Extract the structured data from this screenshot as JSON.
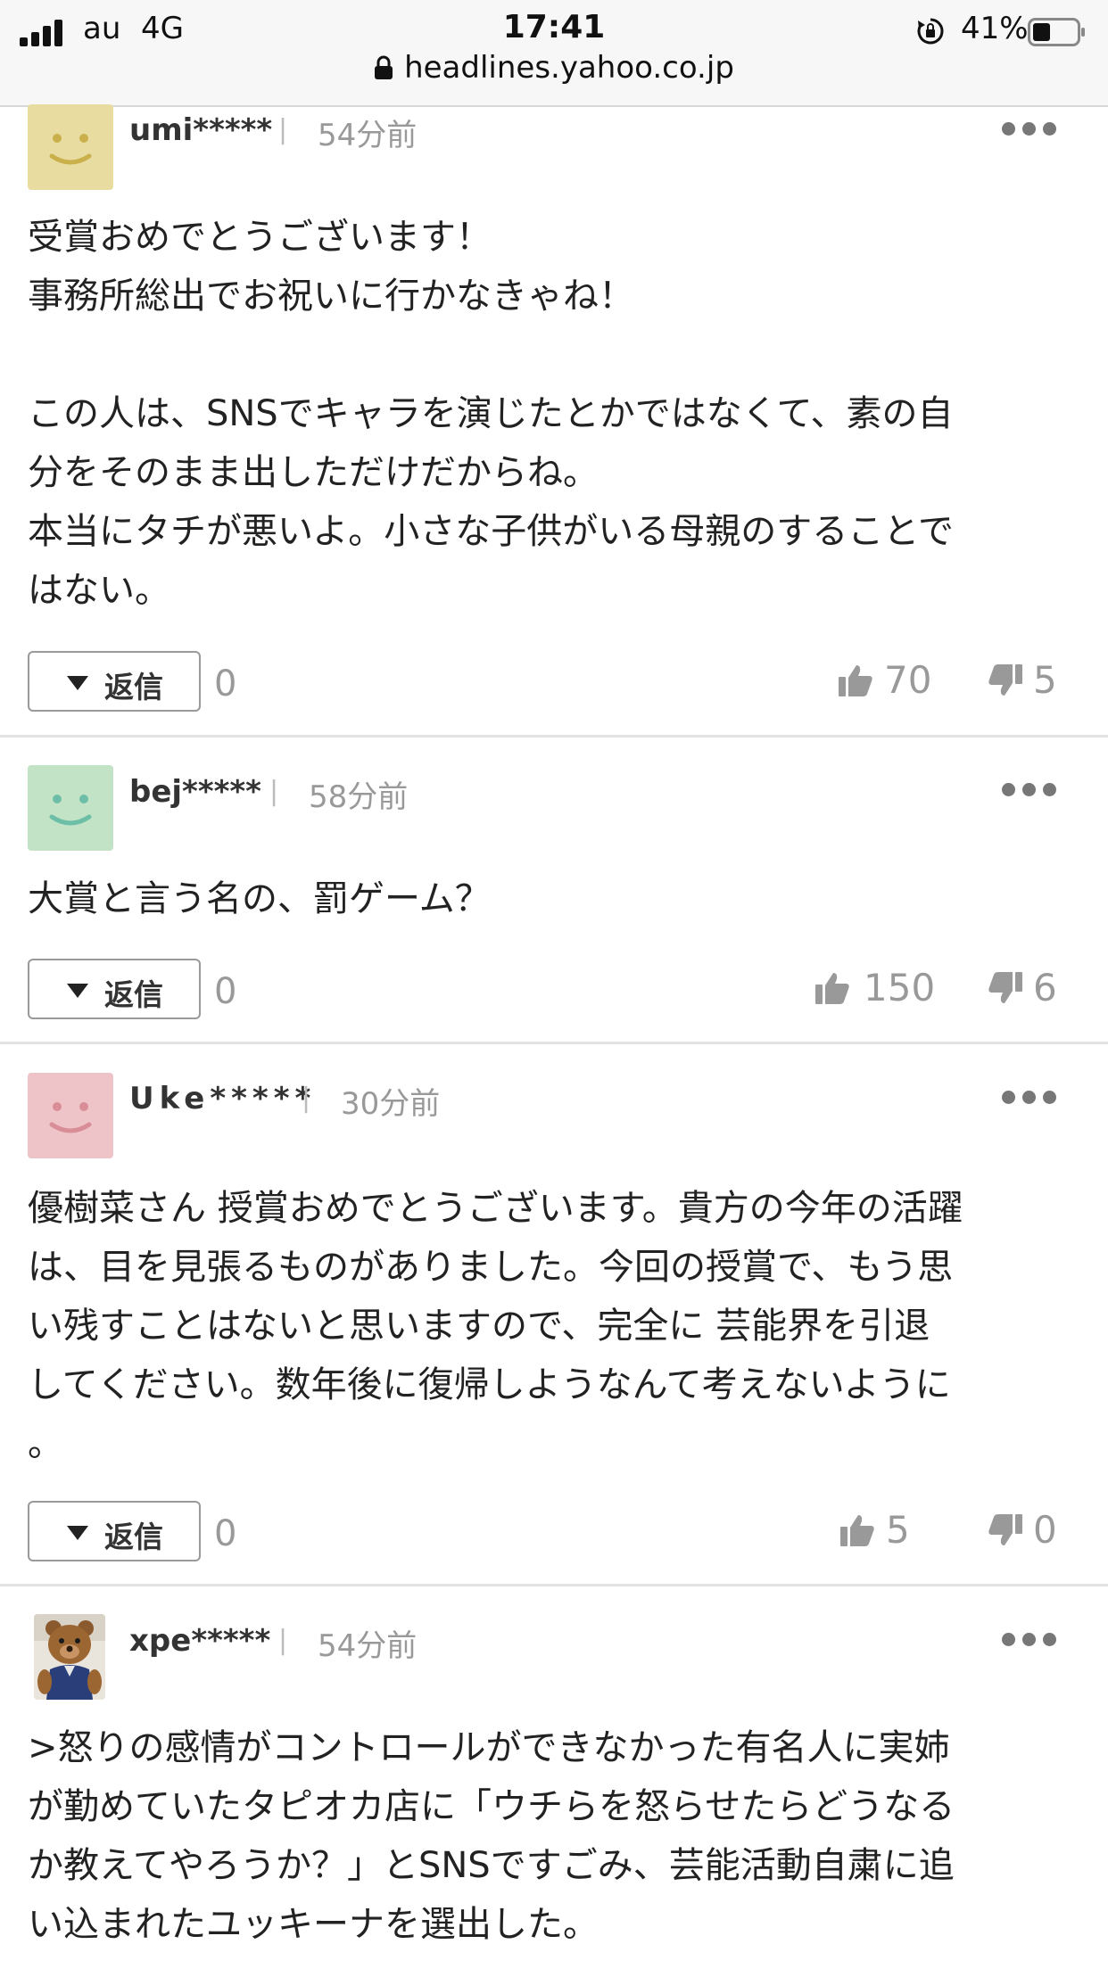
{
  "status": {
    "carrier": "au",
    "network": "4G",
    "time": "17:41",
    "battery": "41%",
    "battery_level": 0.41,
    "url": "headlines.yahoo.co.jp"
  },
  "comments": [
    {
      "user": "umi*****",
      "time": "54分前",
      "avatar_color": "#e8dca0",
      "face_color": "#c9b04a",
      "lines": [
        "受賞おめでとうございます！",
        "事務所総出でお祝いに行かなきゃね！",
        "",
        "この人は、SNSでキャラを演じたとかではなくて、素の自",
        "分をそのまま出しただけだからね。",
        "本当にタチが悪いよ。小さな子供がいる母親のすることで",
        "はない。"
      ],
      "reply_label": "返信",
      "reply_count": "0",
      "likes": "70",
      "dislikes": "5"
    },
    {
      "user": "bej*****",
      "time": "58分前",
      "avatar_color": "#c2e3c6",
      "face_color": "#6cbfa6",
      "lines": [
        "大賞と言う名の、罰ゲーム？"
      ],
      "reply_label": "返信",
      "reply_count": "0",
      "likes": "150",
      "dislikes": "6"
    },
    {
      "user": "Uke*****",
      "time": "30分前",
      "avatar_color": "#eec4c8",
      "face_color": "#d98d96",
      "lines": [
        "優樹菜さん 授賞おめでとうございます。貴方の今年の活躍",
        "は、目を見張るものがありました。今回の授賞で、もう思",
        "い残すことはないと思いますので、完全に 芸能界を引退",
        "してください。数年後に復帰しようなんて考えないように",
        "。"
      ],
      "reply_label": "返信",
      "reply_count": "0",
      "likes": "5",
      "dislikes": "0"
    },
    {
      "user": "xpe*****",
      "time": "54分前",
      "avatar_color": "#e9e4dc",
      "lines": [
        ">怒りの感情がコントロールができなかった有名人に実姉",
        "が勤めていたタピオカ店に「ウチらを怒らせたらどうなる",
        "か教えてやろうか？」とSNSですごみ、芸能活動自粛に追",
        "い込まれたユッキーナを選出した。"
      ]
    }
  ]
}
